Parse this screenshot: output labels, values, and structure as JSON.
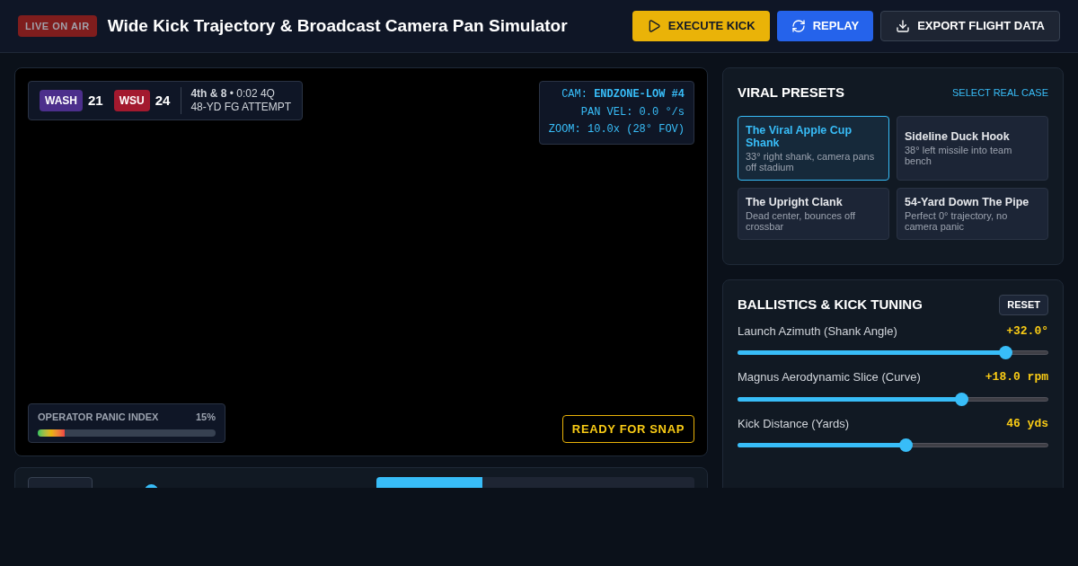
{
  "header": {
    "badge": "LIVE ON AIR",
    "title": "Wide Kick Trajectory & Broadcast Camera Pan Simulator",
    "buttons": [
      {
        "kind": "execute",
        "label": "EXECUTE KICK"
      },
      {
        "kind": "replay",
        "label": "REPLAY"
      },
      {
        "kind": "export",
        "label": "EXPORT FLIGHT DATA"
      }
    ]
  },
  "scoreboard": {
    "teams": [
      {
        "abbr": "WASH",
        "score": "21",
        "color": "#4c2f8c"
      },
      {
        "abbr": "WSU",
        "score": "24",
        "color": "#a3192e"
      }
    ],
    "situation": "**4th & 8** • 0:02 4Q",
    "play": "48-YD FG ATTEMPT"
  },
  "camera": {
    "label": "CAM:",
    "name": "ENDZONE-LOW #4",
    "pan": "PAN VEL: 0.0 °/s",
    "zoom": "ZOOM: 10.0x (28° FOV)"
  },
  "panic": {
    "label": "OPERATOR PANIC INDEX",
    "reading": "15%",
    "level": 0.15
  },
  "status": "READY FOR SNAP",
  "view_tabs": [
    {
      "selected": true
    },
    {
      "selected": false
    },
    {
      "selected": false
    }
  ],
  "presets": {
    "title": "VIRAL PRESETS",
    "link": "SELECT REAL CASE",
    "items": [
      {
        "name": "The Viral Apple Cup Shank",
        "desc": "33° right shank, camera pans off stadium",
        "selected": true
      },
      {
        "name": "Sideline Duck Hook",
        "desc": "38° left missile into team bench",
        "selected": false
      },
      {
        "name": "The Upright Clank",
        "desc": "Dead center, bounces off crossbar",
        "selected": false
      },
      {
        "name": "54-Yard Down The Pipe",
        "desc": "Perfect 0° trajectory, no camera panic",
        "selected": false
      }
    ]
  },
  "tuning": {
    "title": "BALLISTICS & KICK TUNING",
    "reset": "RESET",
    "sliders": [
      {
        "label": "Launch Azimuth (Shank Angle)",
        "reading": "+32.0°",
        "level": 0.86
      },
      {
        "label": "Magnus Aerodynamic Slice (Curve)",
        "reading": "+18.0 rpm",
        "level": 0.72
      },
      {
        "label": "Kick Distance (Yards)",
        "reading": "46 yds",
        "level": 0.54
      }
    ]
  }
}
